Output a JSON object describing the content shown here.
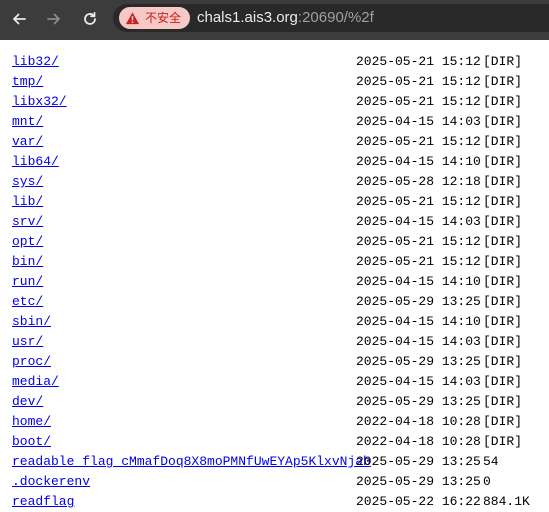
{
  "browser": {
    "security_label": "不安全",
    "url_host": "chals1.ais3.org",
    "url_path": ":20690/%2f",
    "icons": {
      "back": "back-arrow-icon",
      "forward": "forward-arrow-icon",
      "reload": "reload-icon",
      "security": "warning-icon"
    }
  },
  "listing": {
    "entries": [
      {
        "name": "lib32/",
        "date": "2025-05-21 15:12",
        "size": "[DIR]"
      },
      {
        "name": "tmp/",
        "date": "2025-05-21 15:12",
        "size": "[DIR]"
      },
      {
        "name": "libx32/",
        "date": "2025-05-21 15:12",
        "size": "[DIR]"
      },
      {
        "name": "mnt/",
        "date": "2025-04-15 14:03",
        "size": "[DIR]"
      },
      {
        "name": "var/",
        "date": "2025-05-21 15:12",
        "size": "[DIR]"
      },
      {
        "name": "lib64/",
        "date": "2025-04-15 14:10",
        "size": "[DIR]"
      },
      {
        "name": "sys/",
        "date": "2025-05-28 12:18",
        "size": "[DIR]"
      },
      {
        "name": "lib/",
        "date": "2025-05-21 15:12",
        "size": "[DIR]"
      },
      {
        "name": "srv/",
        "date": "2025-04-15 14:03",
        "size": "[DIR]"
      },
      {
        "name": "opt/",
        "date": "2025-05-21 15:12",
        "size": "[DIR]"
      },
      {
        "name": "bin/",
        "date": "2025-05-21 15:12",
        "size": "[DIR]"
      },
      {
        "name": "run/",
        "date": "2025-04-15 14:10",
        "size": "[DIR]"
      },
      {
        "name": "etc/",
        "date": "2025-05-29 13:25",
        "size": "[DIR]"
      },
      {
        "name": "sbin/",
        "date": "2025-04-15 14:10",
        "size": "[DIR]"
      },
      {
        "name": "usr/",
        "date": "2025-04-15 14:03",
        "size": "[DIR]"
      },
      {
        "name": "proc/",
        "date": "2025-05-29 13:25",
        "size": "[DIR]"
      },
      {
        "name": "media/",
        "date": "2025-04-15 14:03",
        "size": "[DIR]"
      },
      {
        "name": "dev/",
        "date": "2025-05-29 13:25",
        "size": "[DIR]"
      },
      {
        "name": "home/",
        "date": "2022-04-18 10:28",
        "size": "[DIR]"
      },
      {
        "name": "boot/",
        "date": "2022-04-18 10:28",
        "size": "[DIR]"
      },
      {
        "name": "readable_flag_cMmafDoq8X8moPMNfUwEYAp5KlxvNjab",
        "date": "2025-05-29 13:25",
        "size": "54"
      },
      {
        "name": ".dockerenv",
        "date": "2025-05-29 13:25",
        "size": "0"
      },
      {
        "name": "readflag",
        "date": "2025-05-22 16:22",
        "size": "884.1K"
      }
    ]
  },
  "colors": {
    "link": "#0000ee",
    "toolbar_bg": "#3c3c3c",
    "security_chip_bg": "#f6c9c6",
    "security_text": "#c5221f"
  }
}
